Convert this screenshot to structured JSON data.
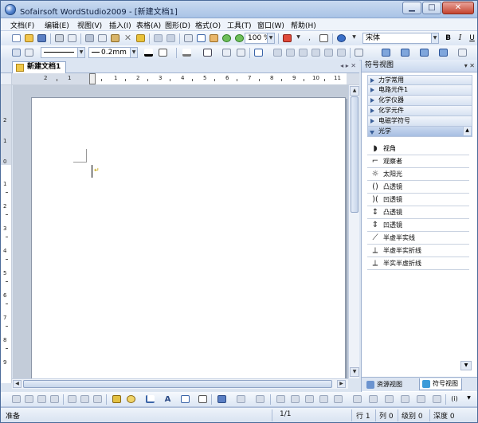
{
  "window": {
    "title": "Sofairsoft WordStudio2009 - [新建文档1]",
    "buttons": {
      "minimize": "▁",
      "maximize": "□",
      "close": "✕"
    }
  },
  "menu": [
    "文档(F)",
    "编辑(E)",
    "视图(V)",
    "插入(I)",
    "表格(A)",
    "图形(D)",
    "格式(O)",
    "工具(T)",
    "窗口(W)",
    "帮助(H)"
  ],
  "toolbar": {
    "zoom": "100 %",
    "line_width": "0.2mm",
    "font": "宋体",
    "bold": "B",
    "italic": "I",
    "underline": "U"
  },
  "document": {
    "tab_label": "新建文档1",
    "strip_controls": "◂ ▸ ✕",
    "ruler_numbers": [
      "2",
      "1",
      "1",
      "2",
      "3",
      "4",
      "5",
      "6",
      "7",
      "8",
      "9",
      "10",
      "11"
    ],
    "vruler_numbers": [
      "2",
      "1",
      "0",
      "1",
      "2",
      "3",
      "4",
      "5",
      "6",
      "7",
      "8",
      "9",
      "10"
    ]
  },
  "panel": {
    "title": "符号视图",
    "title_controls": "▾ ✕",
    "categories": [
      {
        "label": "力学常用",
        "open": false
      },
      {
        "label": "电路元件1",
        "open": false
      },
      {
        "label": "化学仪器",
        "open": false
      },
      {
        "label": "化学元件",
        "open": false
      },
      {
        "label": "电磁学符号",
        "open": false
      },
      {
        "label": "光学",
        "open": true
      }
    ],
    "symbols": [
      {
        "label": "视角",
        "icon": "eye-angle-icon",
        "glyph": "◗"
      },
      {
        "label": "观察者",
        "icon": "observer-icon",
        "glyph": "⌐"
      },
      {
        "label": "太阳光",
        "icon": "sun-icon",
        "glyph": "☼"
      },
      {
        "label": "凸透镜",
        "icon": "convex-lens-icon",
        "glyph": "()"
      },
      {
        "label": "凹透镜",
        "icon": "concave-lens-icon",
        "glyph": ")("
      },
      {
        "label": "凸透镜",
        "icon": "convex-lens-arrow-icon",
        "glyph": "↕"
      },
      {
        "label": "凹透镜",
        "icon": "concave-lens-arrow-icon",
        "glyph": "⇕"
      },
      {
        "label": "半虚半实线",
        "icon": "half-dashed-line-icon",
        "glyph": "⟋"
      },
      {
        "label": "半虚半实折线",
        "icon": "half-dashed-polyline-icon",
        "glyph": "⟂"
      },
      {
        "label": "半实半虚折线",
        "icon": "half-solid-polyline-icon",
        "glyph": "⟂"
      }
    ],
    "tabs": [
      {
        "label": "资源视图",
        "active": false
      },
      {
        "label": "符号视图",
        "active": true
      }
    ]
  },
  "status": {
    "ready": "准备",
    "page": "1/1",
    "line": "行 1",
    "col": "列 0",
    "level": "级别 0",
    "depth": "深度 0"
  }
}
